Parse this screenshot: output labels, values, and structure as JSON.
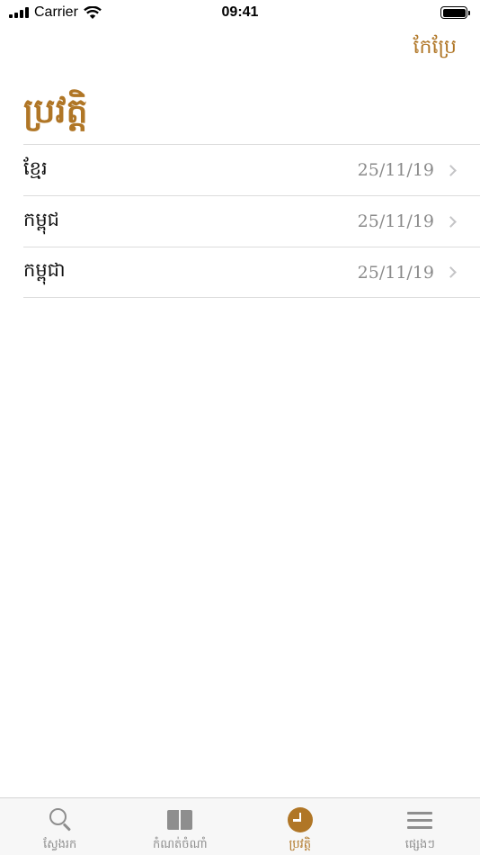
{
  "status_bar": {
    "carrier": "Carrier",
    "time": "09:41",
    "icons": [
      "cellular-signal-icon",
      "wifi-icon",
      "battery-icon"
    ]
  },
  "nav": {
    "edit_label": "កែប្រែ"
  },
  "page_title": "ប្រវត្តិ",
  "history": [
    {
      "word": "ខ្មែរ",
      "date": "25/11/19"
    },
    {
      "word": "កម្ពុជ",
      "date": "25/11/19"
    },
    {
      "word": "កម្ពុជា",
      "date": "25/11/19"
    }
  ],
  "tabs": [
    {
      "label": "ស្វែងរក",
      "icon": "search-icon",
      "active": false
    },
    {
      "label": "កំណត់ចំណាំ",
      "icon": "book-icon",
      "active": false
    },
    {
      "label": "ប្រវត្តិ",
      "icon": "clock-icon",
      "active": true
    },
    {
      "label": "ផ្សេងៗ",
      "icon": "menu-icon",
      "active": false
    }
  ],
  "colors": {
    "accent": "#b07626",
    "inactive": "#8e8e8e",
    "date_text": "#8a8a8a",
    "separator": "#dcdcdc"
  }
}
